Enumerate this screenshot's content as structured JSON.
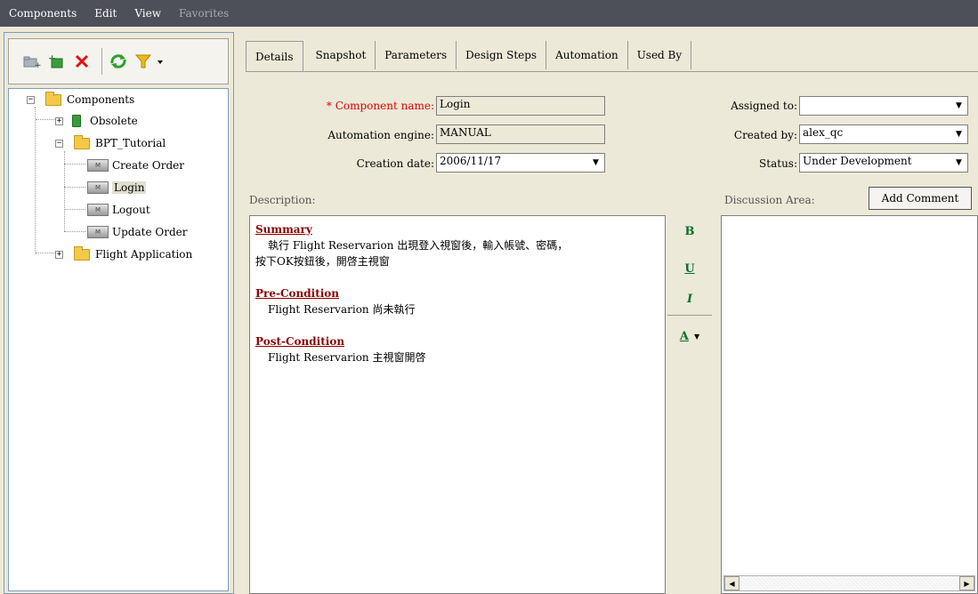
{
  "menu": {
    "items": [
      "Components",
      "Edit",
      "View"
    ],
    "disabled_item": "Favorites"
  },
  "toolbar": {
    "icons": [
      "new-folder-icon",
      "new-component-icon",
      "delete-icon",
      "refresh-icon",
      "filter-icon"
    ]
  },
  "tree": {
    "root": "Components",
    "obsolete": "Obsolete",
    "bpt": "BPT_Tutorial",
    "create_order": "Create Order",
    "login": "Login",
    "logout": "Logout",
    "update_order": "Update Order",
    "flight_app": "Flight Application"
  },
  "tabs": [
    "Details",
    "Snapshot",
    "Parameters",
    "Design Steps",
    "Automation",
    "Used By"
  ],
  "form": {
    "required_mark": "*",
    "component_name_label": "Component name:",
    "component_name_value": "Login",
    "automation_engine_label": "Automation engine:",
    "automation_engine_value": "MANUAL",
    "creation_date_label": "Creation date:",
    "creation_date_value": "2006/11/17",
    "assigned_to_label": "Assigned to:",
    "assigned_to_value": "",
    "created_by_label": "Created by:",
    "created_by_value": "alex_qc",
    "status_label": "Status:",
    "status_value": "Under Development"
  },
  "description": {
    "label": "Description:",
    "summary_heading": "Summary",
    "summary_line1": "執行 Flight Reservarion 出現登入視窗後，輸入帳號、密碼，",
    "summary_line2": "按下OK按鈕後，開啓主視窗",
    "precondition_heading": "Pre-Condition",
    "precondition_text": "Flight Reservarion 尚未執行",
    "postcondition_heading": "Post-Condition",
    "postcondition_text": "Flight Reservarion 主視窗開啓"
  },
  "format": {
    "bold": "B",
    "underline": "U",
    "italic": "I",
    "color": "A"
  },
  "discussion": {
    "label": "Discussion Area:",
    "add_comment": "Add Comment"
  }
}
